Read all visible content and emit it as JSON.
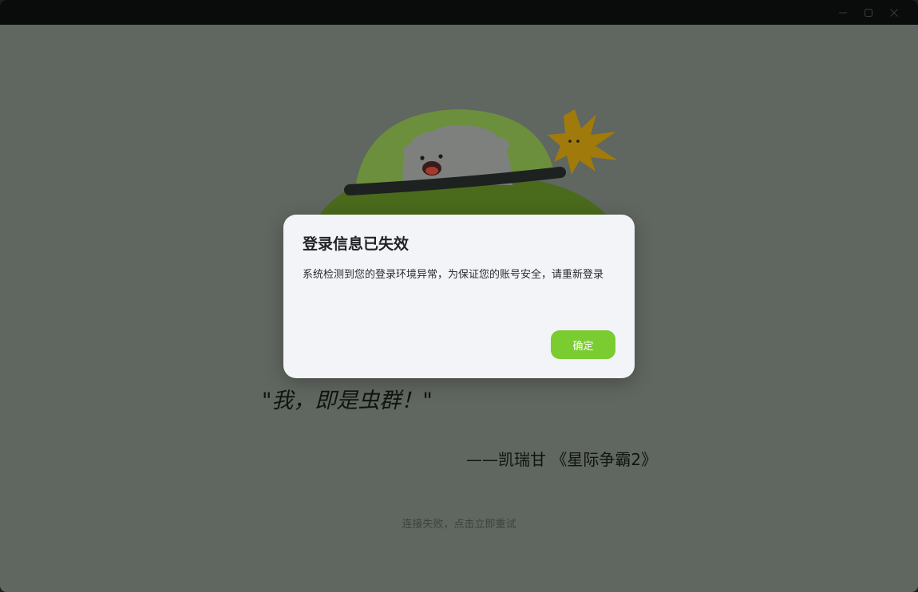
{
  "window": {
    "controls": {
      "minimize_icon": "minimize-icon",
      "maximize_icon": "maximize-icon",
      "close_icon": "close-icon"
    }
  },
  "hero": {
    "illustration": "polar-bear-in-green-pod-with-spiky-star"
  },
  "quote": {
    "text": "\"我，即是虫群！\"",
    "attribution": "——凯瑞甘 《星际争霸2》"
  },
  "status": {
    "retry_text": "连接失败，点击立即重试"
  },
  "dialog": {
    "title": "登录信息已失效",
    "message": "系统检测到您的登录环境异常，为保证您的账号安全，请重新登录",
    "confirm_label": "确定"
  },
  "colors": {
    "background_dimmed": "#606660",
    "titlebar": "#0a0c0b",
    "dialog_bg": "#f3f4f8",
    "accent_green": "#7bcc31"
  }
}
